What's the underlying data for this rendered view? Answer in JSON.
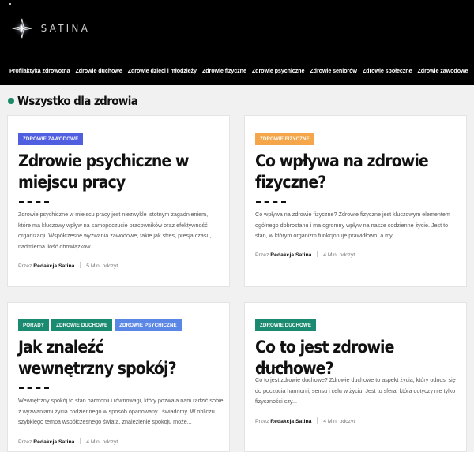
{
  "header": {
    "logo_text": "SATINA",
    "nav": [
      "Profilaktyka zdrowotna",
      "Zdrowie duchowe",
      "Zdrowie dzieci i młodzieży",
      "Zdrowie fizyczne",
      "Zdrowie psychiczne",
      "Zdrowie seniorów",
      "Zdrowie społeczne",
      "Zdrowie zawodowe"
    ]
  },
  "section": {
    "title": "Wszystko dla zdrowia",
    "accent": "#1b8a6b"
  },
  "colors": {
    "blue": "#4f5fe0",
    "orange": "#f5a64a",
    "green": "#1a8a70",
    "lightblue": "#5a86e6"
  },
  "posts": [
    {
      "tags": [
        "Zdrowie zawodowe"
      ],
      "title": "Zdrowie psychiczne w miejscu pracy",
      "excerpt": "Zdrowie psychiczne w miejscu pracy jest niezwykle istotnym zagadnieniem, które ma kluczowy wpływ na samopoczucie pracowników oraz efektywność organizacji. Współczesne wyzwania zawodowe, takie jak stres, presja czasu, nadmierna ilość obowiązków...",
      "by": "Przez",
      "author": "Redakcja Satina",
      "read": "5 Min. odczyt"
    },
    {
      "tags": [
        "Zdrowie fizyczne"
      ],
      "title": "Co wpływa na zdrowie fizyczne?",
      "excerpt": "Co wpływa na zdrowie fizyczne? Zdrowie fizyczne jest kluczowym elementem ogólnego dobrostanu i ma ogromny wpływ na nasze codzienne życie. Jest to stan, w którym organizm funkcjonuje prawidłowo, a my...",
      "by": "Przez",
      "author": "Redakcja Satina",
      "read": "4 Min. odczyt"
    },
    {
      "tags": [
        "Porady",
        "Zdrowie duchowe",
        "Zdrowie psychiczne"
      ],
      "title": "Jak znaleźć wewnętrzny spokój?",
      "excerpt": "Wewnętrzny spokój to stan harmonii i równowagi, który pozwala nam radzić sobie z wyzwaniami życia codziennego w sposób opanowany i świadomy. W obliczu szybkiego tempa współczesnego świata, znalezienie spokoju może...",
      "by": "Przez",
      "author": "Redakcja Satina",
      "read": "4 Min. odczyt"
    },
    {
      "tags": [
        "Zdrowie duchowe"
      ],
      "title": "Co to jest zdrowie duchowe?",
      "excerpt": "Co to jest zdrowie duchowe? Zdrowie duchowe to aspekt życia, który odnosi się do poczucia harmonii, sensu i celu w życiu. Jest to sfera, która dotyczy nie tylko fizyczności czy...",
      "by": "Przez",
      "author": "Redakcja Satina",
      "read": "4 Min. odczyt"
    }
  ]
}
